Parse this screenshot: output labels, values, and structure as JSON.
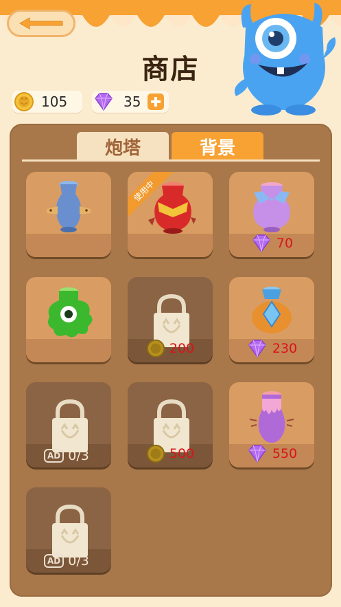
{
  "header": {
    "title": "商店",
    "coins": "105",
    "gems": "35"
  },
  "tabs": [
    {
      "label": "炮塔",
      "active": false
    },
    {
      "label": "背景",
      "active": true
    }
  ],
  "items": [
    {
      "name": "blue-vase",
      "state": "owned"
    },
    {
      "name": "red-vase",
      "state": "in-use",
      "badge": "使用中"
    },
    {
      "name": "purple-vase",
      "state": "buy",
      "currency": "gem",
      "price": "70"
    },
    {
      "name": "green-monster-vase",
      "state": "owned"
    },
    {
      "name": "locked-vase-4",
      "state": "locked",
      "currency": "coin",
      "price": "200"
    },
    {
      "name": "blue-gem-vase",
      "state": "buy",
      "currency": "gem",
      "price": "230"
    },
    {
      "name": "locked-vase-6",
      "state": "locked",
      "currency": "ad",
      "ad_label": "AD",
      "progress": "0/3"
    },
    {
      "name": "locked-vase-7",
      "state": "locked",
      "currency": "coin",
      "price": "500"
    },
    {
      "name": "pink-drip-vase",
      "state": "buy",
      "currency": "gem",
      "price": "550"
    },
    {
      "name": "locked-vase-9",
      "state": "locked",
      "currency": "ad",
      "ad_label": "AD",
      "progress": "0/3"
    }
  ],
  "colors": {
    "accent": "#f7a233",
    "price": "#d8141c",
    "panel": "#a8774a"
  }
}
